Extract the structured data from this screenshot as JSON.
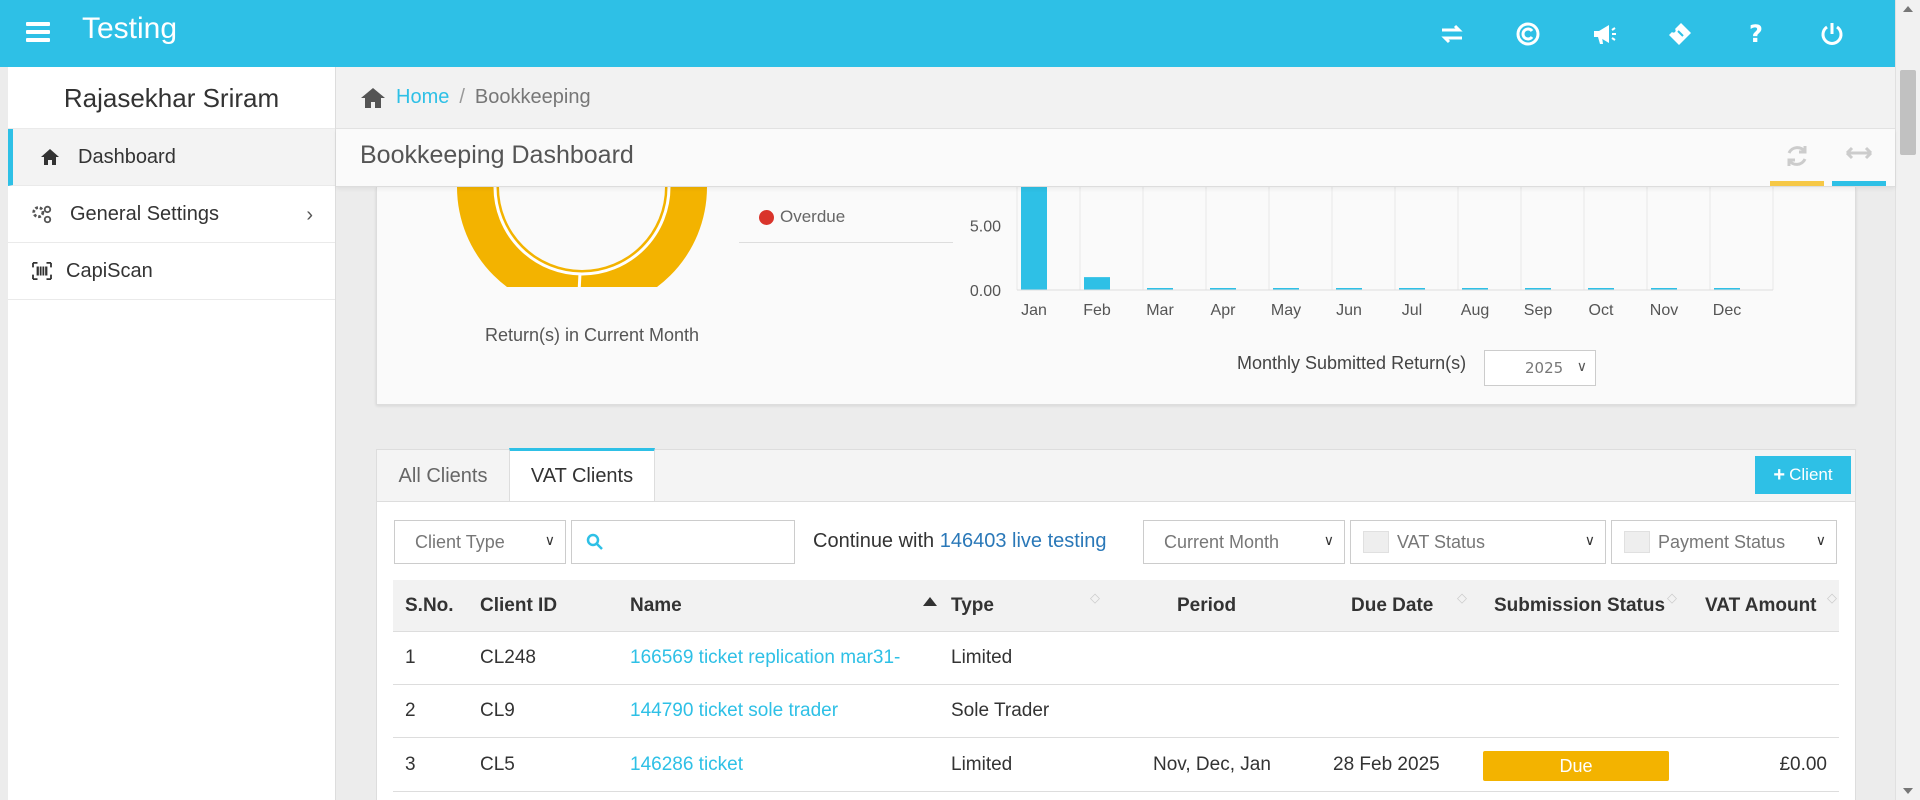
{
  "app": {
    "title": "Testing"
  },
  "topbar": {
    "icons": [
      "transfer-icon",
      "copyright-icon",
      "megaphone-icon",
      "ticket-icon",
      "help-icon",
      "power-icon"
    ],
    "help_glyph": "?"
  },
  "sidebar": {
    "user_name": "Rajasekhar Sriram",
    "items": [
      {
        "label": "Dashboard",
        "icon": "home-icon",
        "active": true
      },
      {
        "label": "General Settings",
        "icon": "gears-icon",
        "has_submenu": true
      },
      {
        "label": "CapiScan",
        "icon": "barcode-icon"
      }
    ]
  },
  "breadcrumb": {
    "home": "Home",
    "separator": "/",
    "current": "Bookkeeping"
  },
  "page": {
    "title": "Bookkeeping Dashboard"
  },
  "donut": {
    "caption": "Return(s) in Current Month",
    "legend": [
      {
        "label": "Overdue",
        "color": "#d9342b"
      }
    ],
    "color": "#f3b300"
  },
  "chart_data": {
    "type": "bar",
    "categories": [
      "Jan",
      "Feb",
      "Mar",
      "Apr",
      "May",
      "Jun",
      "Jul",
      "Aug",
      "Sep",
      "Oct",
      "Nov",
      "Dec"
    ],
    "values": [
      20,
      1,
      0,
      0,
      0,
      0,
      0,
      0,
      0,
      0,
      0,
      0
    ],
    "visible_y_ticks": [
      "5.00",
      "0.00"
    ],
    "tick_values": [
      5,
      0
    ],
    "ylim": [
      0,
      8
    ],
    "caption": "Monthly Submitted Return(s)",
    "bar_color": "#2ec0e6"
  },
  "year_select": {
    "value": "2025"
  },
  "tabs": {
    "all": "All Clients",
    "vat": "VAT Clients",
    "active": "vat"
  },
  "add_client": {
    "label": "Client",
    "plus": "+"
  },
  "filters": {
    "client_type": "Client Type",
    "search_value": "",
    "continue_prefix": "Continue with",
    "continue_link": "146403 live testing",
    "period": "Current Month",
    "vat_status": "VAT Status",
    "payment_status": "Payment Status"
  },
  "table": {
    "columns": [
      "S.No.",
      "Client ID",
      "Name",
      "Type",
      "Period",
      "Due Date",
      "Submission Status",
      "VAT Amount"
    ],
    "rows": [
      {
        "sno": "1",
        "client_id": "CL248",
        "name": "166569 ticket replication mar31-",
        "type": "Limited",
        "period": "",
        "due_date": "",
        "status": "",
        "vat_amount": ""
      },
      {
        "sno": "2",
        "client_id": "CL9",
        "name": "144790 ticket sole trader",
        "type": "Sole Trader",
        "period": "",
        "due_date": "",
        "status": "",
        "vat_amount": ""
      },
      {
        "sno": "3",
        "client_id": "CL5",
        "name": "146286 ticket",
        "type": "Limited",
        "period": "Nov, Dec, Jan",
        "due_date": "28 Feb 2025",
        "status": "Due",
        "vat_amount": "£0.00"
      }
    ]
  },
  "colors": {
    "accent": "#2ec0e6",
    "warning": "#f3b300",
    "danger": "#d9342b"
  }
}
